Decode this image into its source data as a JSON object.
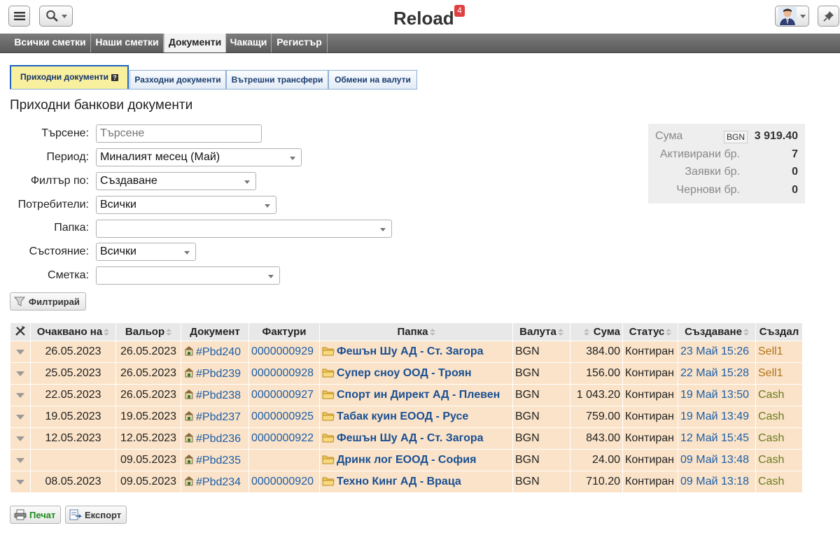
{
  "app": {
    "title": "Reload",
    "notification_count": "4"
  },
  "nav": {
    "items": [
      {
        "label": "Всички сметки"
      },
      {
        "label": "Наши сметки"
      },
      {
        "label": "Документи"
      },
      {
        "label": "Чакащи"
      },
      {
        "label": "Регистър"
      }
    ],
    "active": "Документи"
  },
  "subtabs": [
    {
      "label": "Приходни документи"
    },
    {
      "label": "Разходни документи"
    },
    {
      "label": "Вътрешни трансфери"
    },
    {
      "label": "Обмени на валути"
    }
  ],
  "page_title": "Приходни банкови документи",
  "filters": {
    "search": {
      "label": "Търсене:",
      "placeholder": "Търсене",
      "value": ""
    },
    "period": {
      "label": "Период:",
      "value": "Миналият месец (Май)"
    },
    "filter_by": {
      "label": "Филтър по:",
      "value": "Създаване"
    },
    "users": {
      "label": "Потребители:",
      "value": "Всички"
    },
    "folder": {
      "label": "Папка:",
      "value": ""
    },
    "state": {
      "label": "Състояние:",
      "value": "Всички"
    },
    "account": {
      "label": "Сметка:",
      "value": ""
    },
    "filter_button": "Филтрирай"
  },
  "summary": {
    "sum_label": "Сума",
    "currency": "BGN",
    "sum_value": "3 919.40",
    "activated_label": "Активирани бр.",
    "activated_value": "7",
    "requests_label": "Заявки бр.",
    "requests_value": "0",
    "drafts_label": "Чернови бр.",
    "drafts_value": "0"
  },
  "table": {
    "headers": {
      "expected": "Очаквано на",
      "valor": "Вальор",
      "document": "Документ",
      "invoices": "Фактури",
      "folder": "Папка",
      "currency": "Валута",
      "amount": "Сума",
      "status": "Статус",
      "created": "Създаване",
      "creator": "Създал"
    },
    "rows": [
      {
        "expected": "26.05.2023",
        "valor": "26.05.2023",
        "document": "#Pbd240",
        "invoice": "0000000929",
        "folder": "Фешън Шу АД - Ст. Загора",
        "currency": "BGN",
        "amount": "384.00",
        "status": "Контиран",
        "created": "23 Май 15:26",
        "creator": "Sell1"
      },
      {
        "expected": "25.05.2023",
        "valor": "26.05.2023",
        "document": "#Pbd239",
        "invoice": "0000000928",
        "folder": "Супер сноу ООД - Троян",
        "currency": "BGN",
        "amount": "156.00",
        "status": "Контиран",
        "created": "22 Май 15:28",
        "creator": "Sell1"
      },
      {
        "expected": "22.05.2023",
        "valor": "26.05.2023",
        "document": "#Pbd238",
        "invoice": "0000000927",
        "folder": "Спорт ин Директ АД - Плевен",
        "currency": "BGN",
        "amount": "1 043.20",
        "status": "Контиран",
        "created": "19 Май 13:50",
        "creator": "Cash"
      },
      {
        "expected": "19.05.2023",
        "valor": "19.05.2023",
        "document": "#Pbd237",
        "invoice": "0000000925",
        "folder": "Табак куин ЕООД - Русе",
        "currency": "BGN",
        "amount": "759.00",
        "status": "Контиран",
        "created": "19 Май 13:49",
        "creator": "Cash"
      },
      {
        "expected": "12.05.2023",
        "valor": "12.05.2023",
        "document": "#Pbd236",
        "invoice": "0000000922",
        "folder": "Фешън Шу АД - Ст. Загора",
        "currency": "BGN",
        "amount": "843.00",
        "status": "Контиран",
        "created": "12 Май 15:45",
        "creator": "Cash"
      },
      {
        "expected": "",
        "valor": "09.05.2023",
        "document": "#Pbd235",
        "invoice": "",
        "folder": "Дринк лог ЕООД - София",
        "currency": "BGN",
        "amount": "24.00",
        "status": "Контиран",
        "created": "09 Май 13:48",
        "creator": "Cash"
      },
      {
        "expected": "08.05.2023",
        "valor": "09.05.2023",
        "document": "#Pbd234",
        "invoice": "0000000920",
        "folder": "Техно Кинг АД - Враца",
        "currency": "BGN",
        "amount": "710.20",
        "status": "Контиран",
        "created": "09 Май 13:18",
        "creator": "Cash"
      }
    ]
  },
  "actions": {
    "print": "Печат",
    "export": "Експорт"
  },
  "icons": {
    "menu": "hamburger-menu-icon",
    "search": "magnifier-icon",
    "pin": "pin-icon",
    "avatar": "user-avatar",
    "filter": "funnel-icon",
    "tools": "tools-icon",
    "document": "document-icon",
    "folder": "folder-icon",
    "print": "printer-icon",
    "export": "export-icon"
  }
}
